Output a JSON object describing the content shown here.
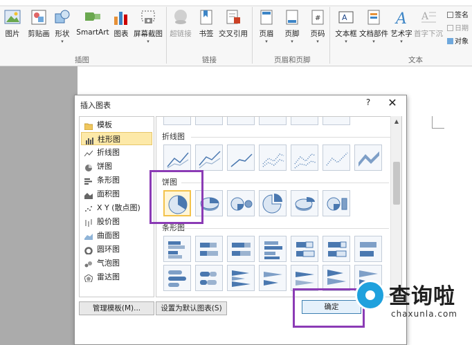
{
  "ribbon": {
    "insert_buttons": [
      {
        "label": "图片",
        "icon": "picture-icon"
      },
      {
        "label": "剪贴画",
        "icon": "clipart-icon"
      },
      {
        "label": "形状",
        "icon": "shapes-icon"
      },
      {
        "label": "SmartArt",
        "icon": "smartart-icon"
      },
      {
        "label": "图表",
        "icon": "chart-icon"
      },
      {
        "label": "屏幕截图",
        "icon": "screenshot-icon"
      }
    ],
    "link_buttons": [
      {
        "label": "超链接",
        "icon": "hyperlink-icon"
      },
      {
        "label": "书签",
        "icon": "bookmark-icon"
      },
      {
        "label": "交叉引用",
        "icon": "cross-reference-icon"
      }
    ],
    "header_buttons": [
      {
        "label": "页眉",
        "icon": "header-icon"
      },
      {
        "label": "页脚",
        "icon": "footer-icon"
      },
      {
        "label": "页码",
        "icon": "page-number-icon"
      }
    ],
    "text_buttons": [
      {
        "label": "文本框",
        "icon": "textbox-icon"
      },
      {
        "label": "文档部件",
        "icon": "quick-parts-icon"
      },
      {
        "label": "艺术字",
        "icon": "wordart-icon"
      },
      {
        "label": "首字下沉",
        "icon": "dropcap-icon"
      }
    ],
    "side_commands": [
      {
        "label": "签名",
        "icon": "signature-icon"
      },
      {
        "label": "日期",
        "icon": "date-icon"
      },
      {
        "label": "对象",
        "icon": "object-icon"
      }
    ],
    "groups": {
      "illustrations": "插图",
      "links": "链接",
      "header_footer": "页眉和页脚",
      "text": "文本"
    }
  },
  "dialog": {
    "title": "插入图表",
    "help": "?",
    "close": "✕",
    "categories": [
      {
        "label": "模板",
        "icon": "templates-folder-icon"
      },
      {
        "label": "柱形图",
        "icon": "column-chart-icon"
      },
      {
        "label": "折线图",
        "icon": "line-chart-icon"
      },
      {
        "label": "饼图",
        "icon": "pie-chart-icon"
      },
      {
        "label": "条形图",
        "icon": "bar-chart-icon"
      },
      {
        "label": "面积图",
        "icon": "area-chart-icon"
      },
      {
        "label": "X Y (散点图)",
        "icon": "scatter-chart-icon"
      },
      {
        "label": "股价图",
        "icon": "stock-chart-icon"
      },
      {
        "label": "曲面图",
        "icon": "surface-chart-icon"
      },
      {
        "label": "圆环图",
        "icon": "doughnut-chart-icon"
      },
      {
        "label": "气泡图",
        "icon": "bubble-chart-icon"
      },
      {
        "label": "雷达图",
        "icon": "radar-chart-icon"
      }
    ],
    "selected_category": "柱形图",
    "sections": {
      "line": "折线图",
      "pie": "饼图",
      "bar": "条形图"
    },
    "manage_templates": "管理模板(M)...",
    "set_default": "设置为默认图表(S)",
    "ok": "确定"
  },
  "watermark": {
    "text": "查询啦",
    "url": "chaxunla.com"
  }
}
